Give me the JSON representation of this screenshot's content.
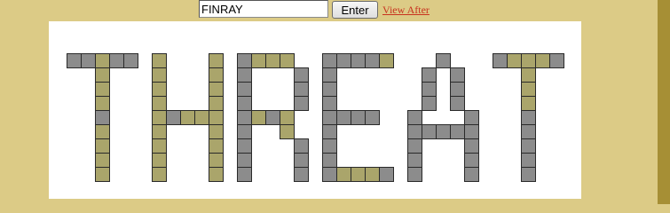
{
  "form": {
    "word_value": "FINRAY",
    "enter_label": "Enter",
    "view_after_label": "View After"
  },
  "board": {
    "word": "THREAT",
    "colors": {
      "page_bg": "#dccb86",
      "board_bg": "#ffffff",
      "gray_tile": "#8c8c8c",
      "olive_tile": "#aaa56b",
      "link": "#c8331f"
    },
    "letters": [
      {
        "char": "T",
        "rows": [
          "GGOGG",
          "..O..",
          "..O..",
          "..O..",
          "..G..",
          "..O..",
          "..O..",
          "..O..",
          "..O.."
        ]
      },
      {
        "char": "H",
        "rows": [
          "O...O",
          "O...O",
          "O...O",
          "O...O",
          "OGOOO",
          "O...O",
          "O...O",
          "O...O",
          "O...O"
        ]
      },
      {
        "char": "R",
        "rows": [
          "GOOO.",
          "G...G",
          "G...G",
          "G...G",
          "GOGO.",
          "G..O.",
          "G...G",
          "G...G",
          "G...G"
        ]
      },
      {
        "char": "E",
        "rows": [
          "GGGGO",
          "G....",
          "G....",
          "G....",
          "GGGG.",
          "G....",
          "G....",
          "G....",
          "GOOOG"
        ]
      },
      {
        "char": "A",
        "rows": [
          "..G..",
          ".G.G.",
          ".G.G.",
          ".G.G.",
          "G...G",
          "GGGGG",
          "G...G",
          "G...G",
          "G...G"
        ]
      },
      {
        "char": "T",
        "rows": [
          "GOOOG",
          "..O..",
          "..O..",
          "..O..",
          "..G..",
          "..G..",
          "..G..",
          "..G..",
          "..G.."
        ]
      }
    ]
  }
}
